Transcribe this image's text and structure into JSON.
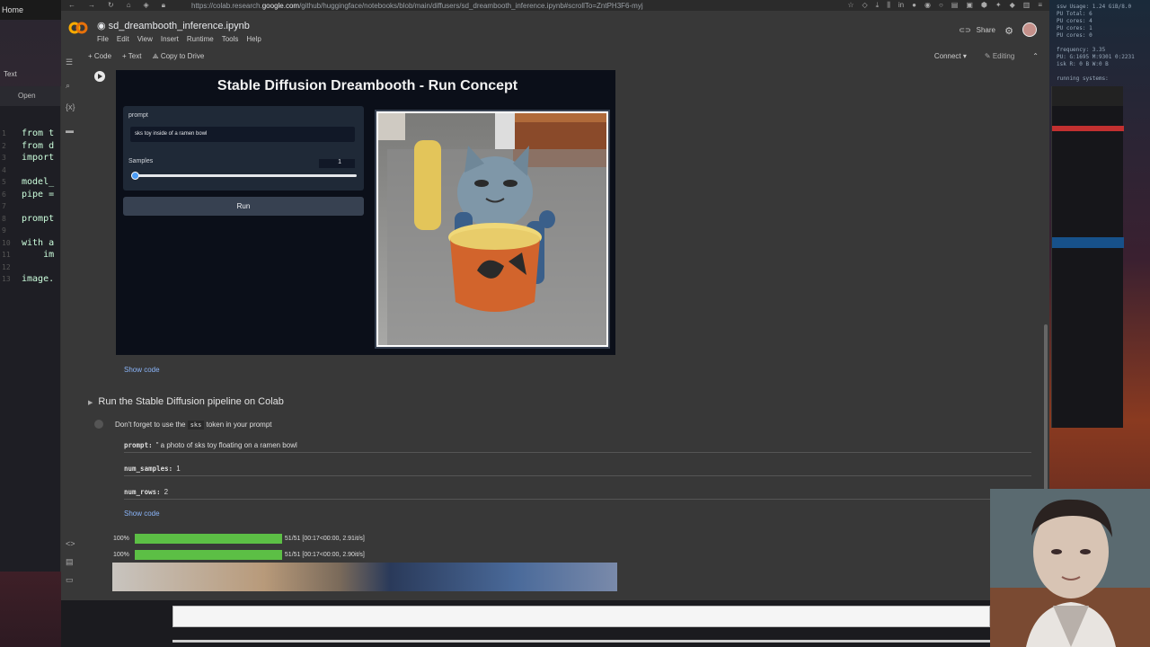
{
  "desktop": {
    "home_label": "Home",
    "text_label": "Text",
    "editor_open": "Open",
    "editor_code": "from t\nfrom d\nimport\n\nmodel_\npipe =\n\nprompt\n\nwith a\n    im\n\nimage.",
    "sysinfo": "ssw Usage: 1.24 GiB/8.0\nPU Total: 6\nPU cores: 4\nPU cores: 1\nPU cores: 0\n\nfrequency: 3.35\nPU: G:1695 M:9301 0:2231\nisk R: 0 B W:0 B\n\nrunning systems:"
  },
  "browser": {
    "url_prefix": "https://colab.research.",
    "url_domain": "google.com",
    "url_path": "/github/huggingface/notebooks/blob/main/diffusers/sd_dreambooth_inference.ipynb#scrollTo=ZntPH3F6-myj"
  },
  "colab": {
    "notebook_title": "sd_dreambooth_inference.ipynb",
    "menu": [
      "File",
      "Edit",
      "View",
      "Insert",
      "Runtime",
      "Tools",
      "Help"
    ],
    "share_label": "Share",
    "toolbar": {
      "code_label": "+ Code",
      "text_label": "+ Text",
      "copy_label": "Copy to Drive",
      "connect_label": "Connect",
      "editing_label": "Editing"
    }
  },
  "gradio": {
    "title": "Stable Diffusion Dreambooth - Run Concept",
    "prompt_label": "prompt",
    "prompt_value": "sks toy inside of a ramen bowl",
    "samples_label": "Samples",
    "samples_value": "1",
    "samples_fraction": 0.0,
    "run_label": "Run"
  },
  "cells": {
    "show_code_label": "Show code",
    "section_title": "Run the Stable Diffusion pipeline on Colab",
    "note_prefix": "Don't forget to use the",
    "note_token": "sks",
    "note_suffix": "token in your prompt",
    "params": [
      {
        "key": "prompt:",
        "value": "\" a photo of sks toy floating on a ramen bowl"
      },
      {
        "key": "num_samples:",
        "value": "1"
      },
      {
        "key": "num_rows:",
        "value": "2"
      }
    ],
    "progress": [
      {
        "percent": "100%",
        "fraction": 1.0,
        "text": "51/51 [00:17<00:00, 2.91it/s]"
      },
      {
        "percent": "100%",
        "fraction": 1.0,
        "text": "51/51 [00:17<00:00, 2.90it/s]"
      }
    ]
  },
  "colors": {
    "accent_blue": "#8ab4f8",
    "progress_green": "#5cbf45",
    "gradio_bg": "#0b0f19"
  }
}
